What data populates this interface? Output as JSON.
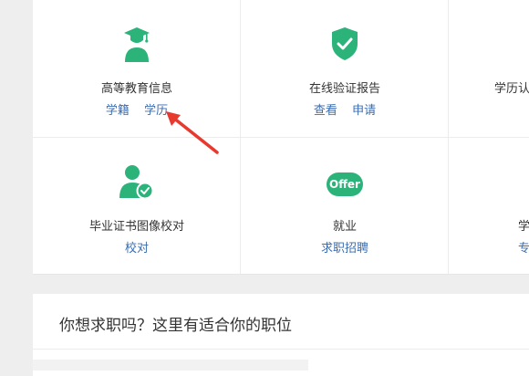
{
  "services": [
    {
      "title": "高等教育信息",
      "links": [
        "学籍",
        "学历"
      ]
    },
    {
      "title": "在线验证报告",
      "links": [
        "查看",
        "申请"
      ]
    },
    {
      "title": "学历认",
      "links": []
    },
    {
      "title": "毕业证书图像校对",
      "links": [
        "校对"
      ]
    },
    {
      "title": "就业",
      "links": [
        "求职招聘"
      ]
    },
    {
      "title": "学",
      "links": [
        "专"
      ]
    }
  ],
  "offer_badge": "Offer",
  "jobs_section": {
    "heading": "你想求职吗？这里有适合你的职位"
  },
  "colors": {
    "accent_green": "#2bb37a",
    "link_blue": "#3b6db0",
    "arrow_red": "#e8392f"
  },
  "icons": [
    "graduate-icon",
    "shield-check-icon",
    "user-check-icon",
    "offer-badge-icon",
    "red-arrow-annotation"
  ]
}
